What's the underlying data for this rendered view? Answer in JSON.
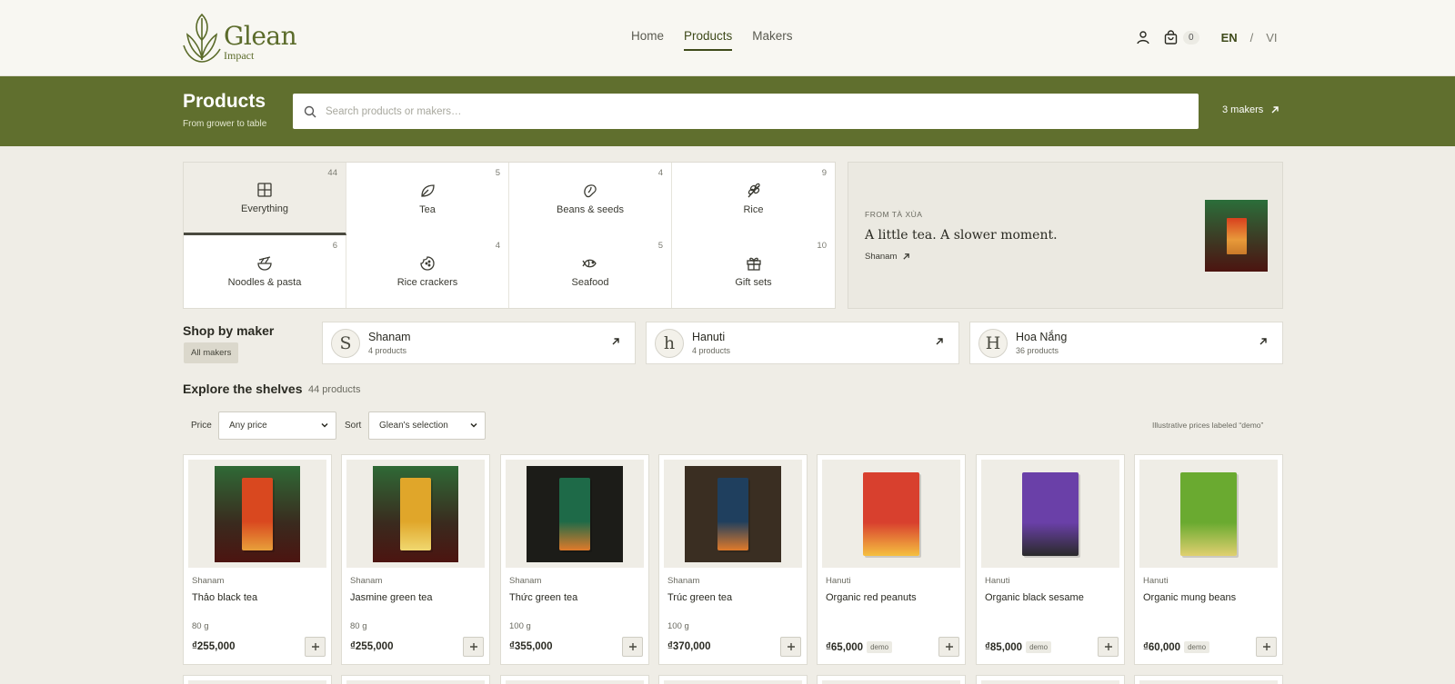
{
  "header": {
    "logo_name": "Glean",
    "logo_sub": "Impact",
    "nav": [
      {
        "label": "Home"
      },
      {
        "label": "Products",
        "active": true
      },
      {
        "label": "Makers"
      }
    ],
    "cart_count": "0",
    "lang": {
      "en": "EN",
      "separator": "/",
      "vi": "VI"
    }
  },
  "banner": {
    "title": "Products",
    "subtitle": "From grower to table",
    "search_placeholder": "Search products or makers…",
    "makers_link": "3 makers"
  },
  "categories": [
    {
      "label": "Everything",
      "count": "44",
      "icon": "grid-icon",
      "active": true
    },
    {
      "label": "Tea",
      "count": "5",
      "icon": "leaf-icon"
    },
    {
      "label": "Beans & seeds",
      "count": "4",
      "icon": "bean-icon"
    },
    {
      "label": "Rice",
      "count": "9",
      "icon": "rice-icon"
    },
    {
      "label": "Noodles & pasta",
      "count": "6",
      "icon": "bowl-icon"
    },
    {
      "label": "Rice crackers",
      "count": "4",
      "icon": "cracker-icon"
    },
    {
      "label": "Seafood",
      "count": "5",
      "icon": "fish-icon"
    },
    {
      "label": "Gift sets",
      "count": "10",
      "icon": "gift-icon"
    }
  ],
  "feature": {
    "eyebrow": "FROM TÀ XÙA",
    "title": "A little tea. A slower moment.",
    "link": "Shanam"
  },
  "makers_section": {
    "title": "Shop by maker",
    "all_label": "All makers",
    "makers": [
      {
        "initial": "S",
        "name": "Shanam",
        "count": "4 products"
      },
      {
        "initial": "h",
        "name": "Hanuti",
        "count": "4 products"
      },
      {
        "initial": "H",
        "name": "Hoa Nắng",
        "count": "36 products"
      }
    ]
  },
  "explore": {
    "title": "Explore the shelves",
    "count": "44 products",
    "price_label": "Price",
    "price_value": "Any price",
    "sort_label": "Sort",
    "sort_value": "Glean's selection",
    "note": "Illustrative prices labeled “demo”"
  },
  "products": [
    {
      "maker": "Shanam",
      "name": "Thảo black tea",
      "weight": "80 g",
      "price": "₫255,000",
      "demo": "",
      "colors": {
        "bg": "#2f6a36",
        "box": "#d9481f",
        "accent": "#e8a03a"
      }
    },
    {
      "maker": "Shanam",
      "name": "Jasmine green tea",
      "weight": "80 g",
      "price": "₫255,000",
      "demo": "",
      "colors": {
        "bg": "#2f6a36",
        "box": "#e0a62a",
        "accent": "#f0d870"
      }
    },
    {
      "maker": "Shanam",
      "name": "Thức green tea",
      "weight": "100 g",
      "price": "₫355,000",
      "demo": "",
      "colors": {
        "bg": "#1c1c18",
        "box": "#1e6a48",
        "accent": "#e07a2a"
      }
    },
    {
      "maker": "Shanam",
      "name": "Trúc green tea",
      "weight": "100 g",
      "price": "₫370,000",
      "demo": "",
      "colors": {
        "bg": "#3a2e22",
        "box": "#1f3f5e",
        "accent": "#e07a2a"
      }
    },
    {
      "maker": "Hanuti",
      "name": "Organic red peanuts",
      "weight": "",
      "price": "₫65,000",
      "demo": "demo",
      "colors": {
        "bg": "#efede6",
        "box": "#d8402e",
        "accent": "#f5c040"
      }
    },
    {
      "maker": "Hanuti",
      "name": "Organic black sesame",
      "weight": "",
      "price": "₫85,000",
      "demo": "demo",
      "colors": {
        "bg": "#efede6",
        "box": "#6a40a8",
        "accent": "#2a2a2a"
      }
    },
    {
      "maker": "Hanuti",
      "name": "Organic mung beans",
      "weight": "",
      "price": "₫60,000",
      "demo": "demo",
      "colors": {
        "bg": "#efede6",
        "box": "#6aaa30",
        "accent": "#e0d070"
      }
    }
  ],
  "colors": {
    "brand": "#606f2e",
    "background": "#efede6",
    "text": "#2a2a22"
  }
}
